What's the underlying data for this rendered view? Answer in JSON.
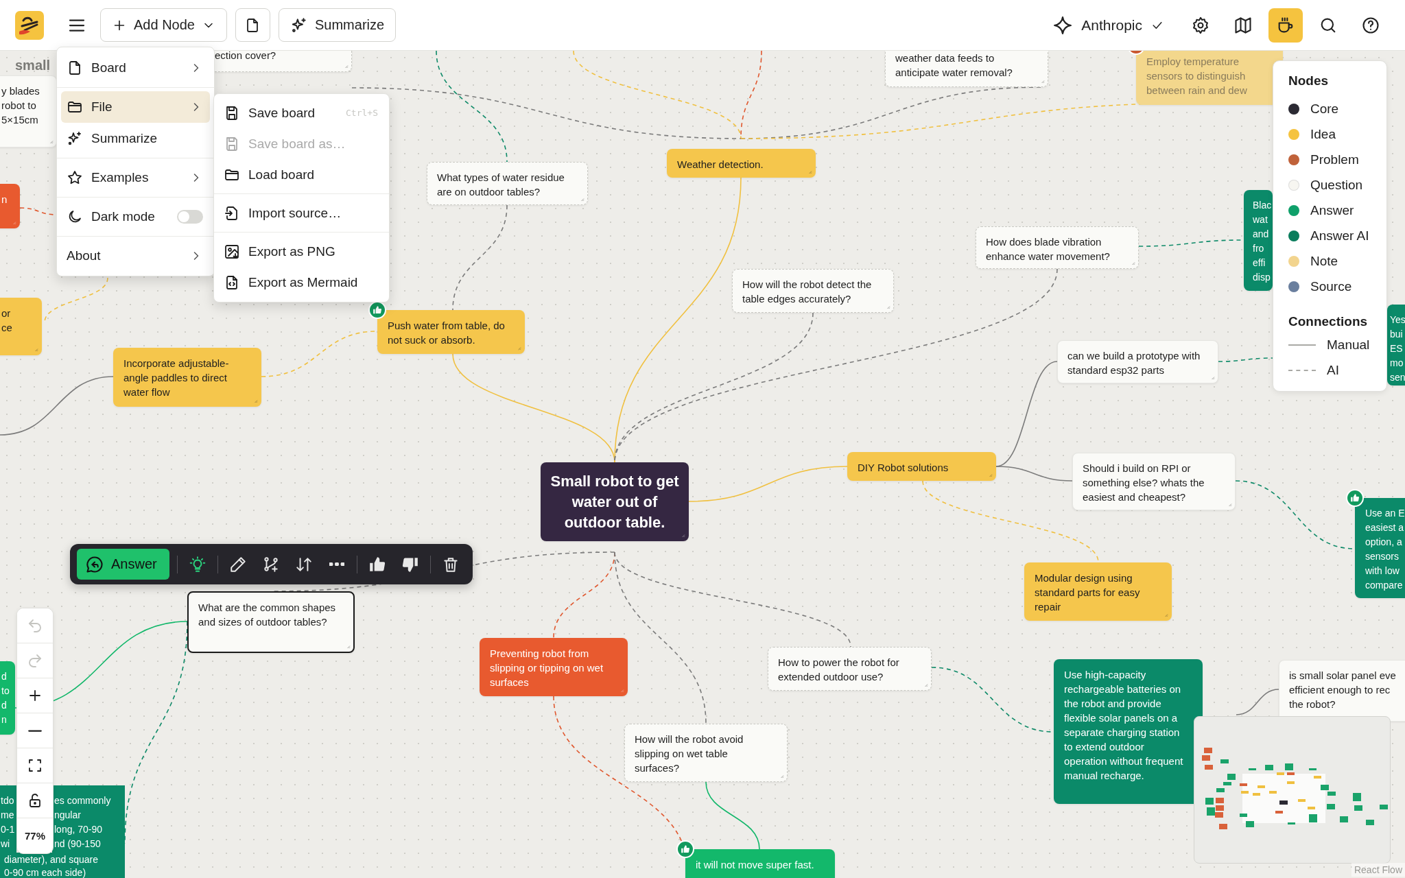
{
  "header": {
    "add_node": "Add Node",
    "summarize": "Summarize",
    "provider": "Anthropic",
    "provider_checked": true,
    "tools": [
      {
        "kind": "settings",
        "selected": false
      },
      {
        "kind": "map",
        "selected": false
      },
      {
        "kind": "coffee",
        "selected": true
      },
      {
        "kind": "search",
        "selected": false
      },
      {
        "kind": "help",
        "selected": false
      }
    ]
  },
  "canvas_label": "small",
  "nodes": [
    {
      "kind": "question",
      "text": "ection cover?",
      "ai": true,
      "selected": false,
      "liked": false,
      "flagged": false
    },
    {
      "kind": "question",
      "text": "y blades\nrobot to\n5×15cm",
      "ai": false,
      "selected": false,
      "liked": false,
      "flagged": false
    },
    {
      "kind": "problem",
      "text": "n",
      "ai": false,
      "selected": false,
      "liked": false,
      "flagged": false
    },
    {
      "kind": "idea",
      "text": "or\nce",
      "ai": false,
      "selected": false,
      "liked": false,
      "flagged": false
    },
    {
      "kind": "idea",
      "text": "Incorporate adjustable-angle paddles to direct water flow",
      "ai": false,
      "selected": false,
      "liked": false,
      "flagged": false
    },
    {
      "kind": "idea",
      "text": "Push water from table, do not suck or absorb.",
      "ai": false,
      "selected": false,
      "liked": true,
      "flagged": false
    },
    {
      "kind": "question",
      "text": "What types of water residue are on outdoor tables?",
      "ai": true,
      "selected": false,
      "liked": false,
      "flagged": false
    },
    {
      "kind": "idea",
      "text": "Weather detection.",
      "ai": false,
      "selected": false,
      "liked": false,
      "flagged": false
    },
    {
      "kind": "question",
      "text": "weather data feeds to\nanticipate water removal?",
      "ai": true,
      "selected": false,
      "liked": false,
      "flagged": false
    },
    {
      "kind": "note",
      "text": "Employ temperature sensors to distinguish between rain and dew",
      "ai": false,
      "selected": false,
      "liked": false,
      "flagged": true
    },
    {
      "kind": "answer_ai",
      "text": "Blac\nwat\nand\nfro\neffi\ndisp",
      "ai": false,
      "selected": false,
      "liked": false,
      "flagged": false
    },
    {
      "kind": "answer_ai",
      "text": "Yes\nbui\nES\nmo\nsen",
      "ai": false,
      "selected": false,
      "liked": false,
      "flagged": false
    },
    {
      "kind": "question",
      "text": "How does blade vibration enhance water movement?",
      "ai": true,
      "selected": false,
      "liked": false,
      "flagged": false
    },
    {
      "kind": "question",
      "text": "How will the robot detect the table edges accurately?",
      "ai": true,
      "selected": false,
      "liked": false,
      "flagged": false
    },
    {
      "kind": "question",
      "text": "can we build a prototype with standard esp32 parts",
      "ai": false,
      "selected": false,
      "liked": false,
      "flagged": false
    },
    {
      "kind": "core",
      "text": "Small robot to get water out of outdoor table.",
      "ai": false,
      "selected": false,
      "liked": false,
      "flagged": false
    },
    {
      "kind": "idea",
      "text": "DIY Robot solutions",
      "ai": false,
      "selected": false,
      "liked": false,
      "flagged": false
    },
    {
      "kind": "question",
      "text": "Should i build on RPI or something else? whats the easiest and cheapest?",
      "ai": false,
      "selected": false,
      "liked": false,
      "flagged": false
    },
    {
      "kind": "answer_ai",
      "text": "Use an E\neasiest a\noption, a\nsensors\nwith low\ncompare",
      "ai": false,
      "selected": false,
      "liked": true,
      "flagged": false
    },
    {
      "kind": "idea",
      "text": "Modular design using standard parts for easy repair",
      "ai": false,
      "selected": false,
      "liked": false,
      "flagged": false
    },
    {
      "kind": "question",
      "text": "What are the common shapes and sizes of outdoor tables?",
      "ai": true,
      "selected": true,
      "liked": false,
      "flagged": false
    },
    {
      "kind": "problem",
      "text": "Preventing robot from slipping or tipping on wet surfaces",
      "ai": false,
      "selected": false,
      "liked": false,
      "flagged": false
    },
    {
      "kind": "question",
      "text": "How to power the robot for extended outdoor use?",
      "ai": true,
      "selected": false,
      "liked": false,
      "flagged": false
    },
    {
      "kind": "question",
      "text": "How will the robot avoid slipping on wet table surfaces?",
      "ai": true,
      "selected": false,
      "liked": false,
      "flagged": false
    },
    {
      "kind": "answer",
      "text": "it will not move super fast.",
      "ai": false,
      "selected": false,
      "liked": true,
      "flagged": false
    },
    {
      "kind": "answer",
      "text": "d\nto\nd\nn",
      "ai": false,
      "selected": false,
      "liked": false,
      "flagged": false
    },
    {
      "kind": "answer_ai",
      "text": "Use high-capacity rechargeable batteries on the robot and provide flexible solar panels on a separate charging station to extend outdoor operation without frequent manual recharge.",
      "ai": false,
      "selected": false,
      "liked": false,
      "flagged": false
    },
    {
      "kind": "question",
      "text": "is small solar panel eve\nefficient enough to rec\nthe robot?",
      "ai": false,
      "selected": false,
      "liked": false,
      "flagged": false
    },
    {
      "kind": "answer_ai",
      "text": [
        "tdo\nme\n0-1\nwi",
        "es commonly\nngular\nlong, 70-90\nnd (90-150",
        "diameter), and square\n0-90 cm each side)"
      ],
      "ai": false,
      "selected": false,
      "liked": false,
      "flagged": false
    }
  ],
  "edges": [
    {
      "kind": "ai",
      "color": "#7b7b7b"
    },
    {
      "kind": "ai",
      "color": "#0e8a68"
    },
    {
      "kind": "ai",
      "color": "#f0c040"
    },
    {
      "kind": "ai",
      "color": "#e0582f"
    },
    {
      "kind": "ai",
      "color": "#7b7b7b"
    },
    {
      "kind": "ai",
      "color": "#f0c040"
    },
    {
      "kind": "manual",
      "color": "#f0c040"
    },
    {
      "kind": "ai",
      "color": "#7b7b7b"
    },
    {
      "kind": "manual",
      "color": "#f0c040"
    },
    {
      "kind": "ai",
      "color": "#f0c040"
    },
    {
      "kind": "ai",
      "color": "#f0c040"
    },
    {
      "kind": "ai",
      "color": "#e0582f"
    },
    {
      "kind": "manual",
      "color": "#7b7b7b"
    },
    {
      "kind": "ai",
      "color": "#7b7b7b"
    },
    {
      "kind": "ai",
      "color": "#7b7b7b"
    },
    {
      "kind": "ai",
      "color": "#0e8a68"
    },
    {
      "kind": "ai",
      "color": "#0e8a68"
    },
    {
      "kind": "manual",
      "color": "#7b7b7b"
    },
    {
      "kind": "manual",
      "color": "#7b7b7b"
    },
    {
      "kind": "ai",
      "color": "#0e8a68"
    },
    {
      "kind": "manual",
      "color": "#f0c040"
    },
    {
      "kind": "ai",
      "color": "#f0c040"
    },
    {
      "kind": "ai",
      "color": "#7b7b7b"
    },
    {
      "kind": "ai",
      "color": "#e0582f"
    },
    {
      "kind": "ai",
      "color": "#7b7b7b"
    },
    {
      "kind": "ai",
      "color": "#7b7b7b"
    },
    {
      "kind": "ai",
      "color": "#0e8a68"
    },
    {
      "kind": "ai",
      "color": "#e0582f"
    },
    {
      "kind": "manual",
      "color": "#12b76a"
    },
    {
      "kind": "manual",
      "color": "#12b76a"
    },
    {
      "kind": "ai",
      "color": "#0e8a68"
    },
    {
      "kind": "manual",
      "color": "#7b7b7b"
    }
  ],
  "toolbar": {
    "answer": "Answer"
  },
  "controls": {
    "buttons": [
      {
        "kind": "undo",
        "disabled": true
      },
      {
        "kind": "redo",
        "disabled": true
      },
      {
        "kind": "zoom_in",
        "disabled": false
      },
      {
        "kind": "zoom_out",
        "disabled": false
      },
      {
        "kind": "fit",
        "disabled": false
      },
      {
        "kind": "lock",
        "disabled": false
      }
    ],
    "zoom": "77%"
  },
  "menu": {
    "groups": [
      {
        "items": [
          {
            "kind": "item",
            "label": "Board",
            "submenu": true,
            "selected": false
          }
        ]
      },
      {
        "items": [
          {
            "kind": "item",
            "label": "File",
            "submenu": true,
            "selected": true
          },
          {
            "kind": "item",
            "label": "Summarize",
            "submenu": false,
            "selected": false
          }
        ]
      },
      {
        "items": [
          {
            "kind": "item",
            "label": "Examples",
            "submenu": true,
            "selected": false
          }
        ]
      },
      {
        "items": [
          {
            "kind": "toggle",
            "label": "Dark mode",
            "on": false
          }
        ]
      },
      {
        "items": [
          {
            "kind": "item",
            "label": "About",
            "submenu": true,
            "selected": false
          }
        ]
      }
    ]
  },
  "submenu": {
    "groups": [
      {
        "items": [
          {
            "label": "Save board",
            "shortcut": "Ctrl+S",
            "disabled": false
          },
          {
            "label": "Save board as…",
            "disabled": true
          },
          {
            "label": "Load board",
            "disabled": false
          }
        ]
      },
      {
        "items": [
          {
            "label": "Import source…",
            "disabled": false
          }
        ]
      },
      {
        "items": [
          {
            "label": "Export as PNG",
            "disabled": false
          },
          {
            "label": "Export as Mermaid",
            "disabled": false
          }
        ]
      }
    ]
  },
  "legend": {
    "nodes_title": "Nodes",
    "node_types": [
      {
        "label": "Core",
        "color": "#2b2a33"
      },
      {
        "label": "Idea",
        "color": "#f5c33f"
      },
      {
        "label": "Problem",
        "color": "#c0623a"
      },
      {
        "label": "Question",
        "color": "#f7f6f1"
      },
      {
        "label": "Answer",
        "color": "#0fa06a"
      },
      {
        "label": "Answer AI",
        "color": "#0a7d5c"
      },
      {
        "label": "Note",
        "color": "#f2d48e"
      },
      {
        "label": "Source",
        "color": "#6a7f9e"
      }
    ],
    "connections_title": "Connections",
    "connection_types": [
      {
        "label": "Manual",
        "kind": "solid"
      },
      {
        "label": "AI",
        "kind": "dashed"
      }
    ]
  },
  "attribution": "React Flow"
}
